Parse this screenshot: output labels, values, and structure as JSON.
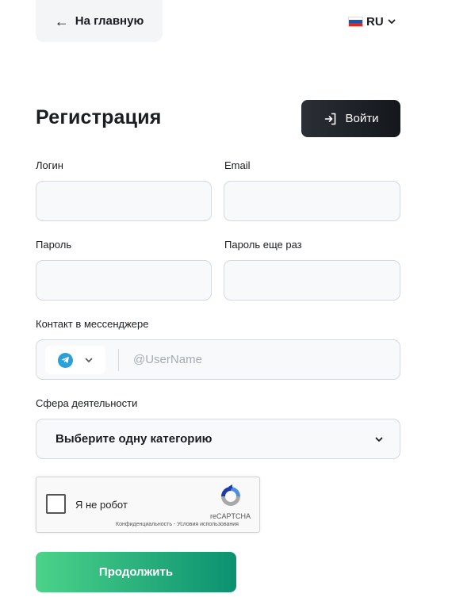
{
  "nav": {
    "back_label": "На главную",
    "back_arrow": "←"
  },
  "lang": {
    "code": "RU",
    "flag": "russia-flag"
  },
  "form": {
    "title": "Регистрация",
    "login_button": "Войти",
    "fields": {
      "login": {
        "label": "Логин",
        "value": ""
      },
      "email": {
        "label": "Email",
        "value": ""
      },
      "password": {
        "label": "Пароль",
        "value": ""
      },
      "password_repeat": {
        "label": "Пароль еще раз",
        "value": ""
      }
    },
    "messenger": {
      "label": "Контакт в мессенджере",
      "selected": "telegram-icon",
      "placeholder": "@UserName",
      "value": ""
    },
    "activity": {
      "label": "Сфера деятельности",
      "selected": "Выберите одну категорию"
    },
    "captcha": {
      "label": "Я не робот",
      "brand": "reCAPTCHA",
      "terms": "Конфиденциальность - Условия использования"
    },
    "submit_label": "Продолжить"
  },
  "colors": {
    "accent_start": "#4bd38a",
    "accent_end": "#0b9170",
    "dark_button": "#1a1d22",
    "telegram": "#2a9fd9"
  }
}
